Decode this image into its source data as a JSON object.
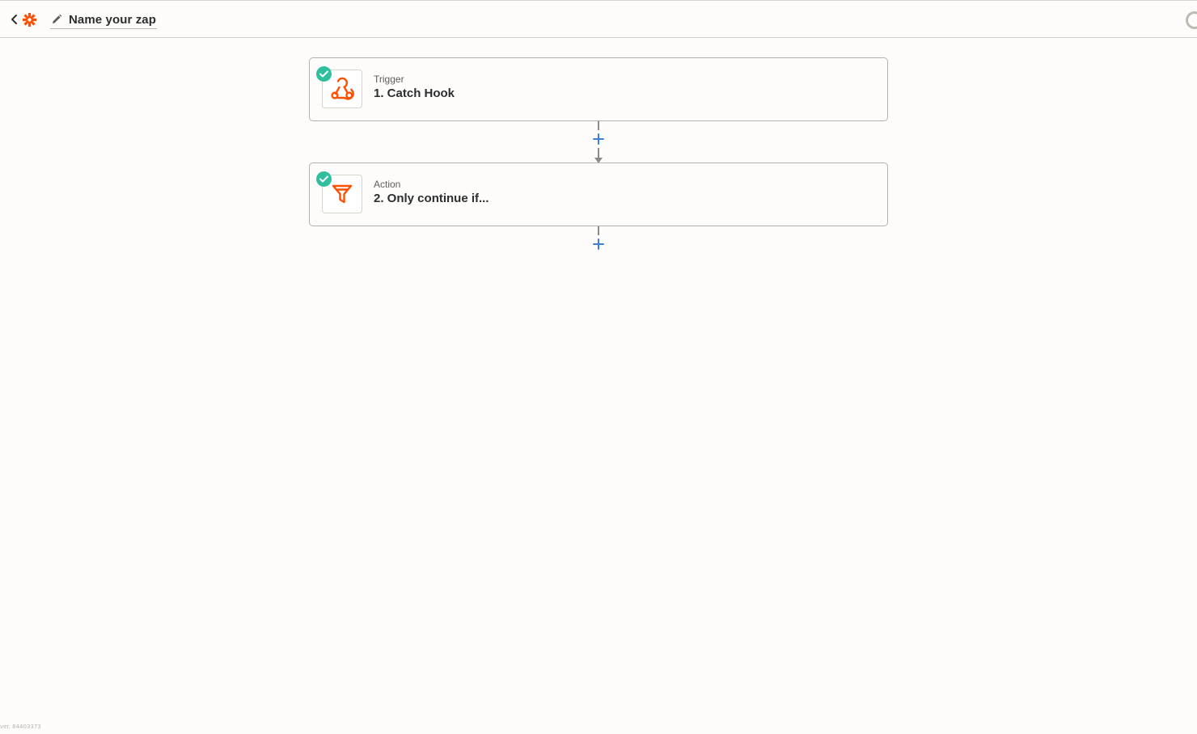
{
  "header": {
    "zap_name": "Name your zap",
    "brand_color": "#ff4f00"
  },
  "steps": [
    {
      "kind": "Trigger",
      "title": "1. Catch Hook",
      "icon": "webhook-icon",
      "status": "complete"
    },
    {
      "kind": "Action",
      "title": "2. Only continue if...",
      "icon": "filter-icon",
      "status": "complete"
    }
  ],
  "colors": {
    "accent": "#ff4f00",
    "success": "#2fbf9f",
    "add_button": "#3d7fe0"
  },
  "footer": {
    "version": "ver. 84403373"
  }
}
